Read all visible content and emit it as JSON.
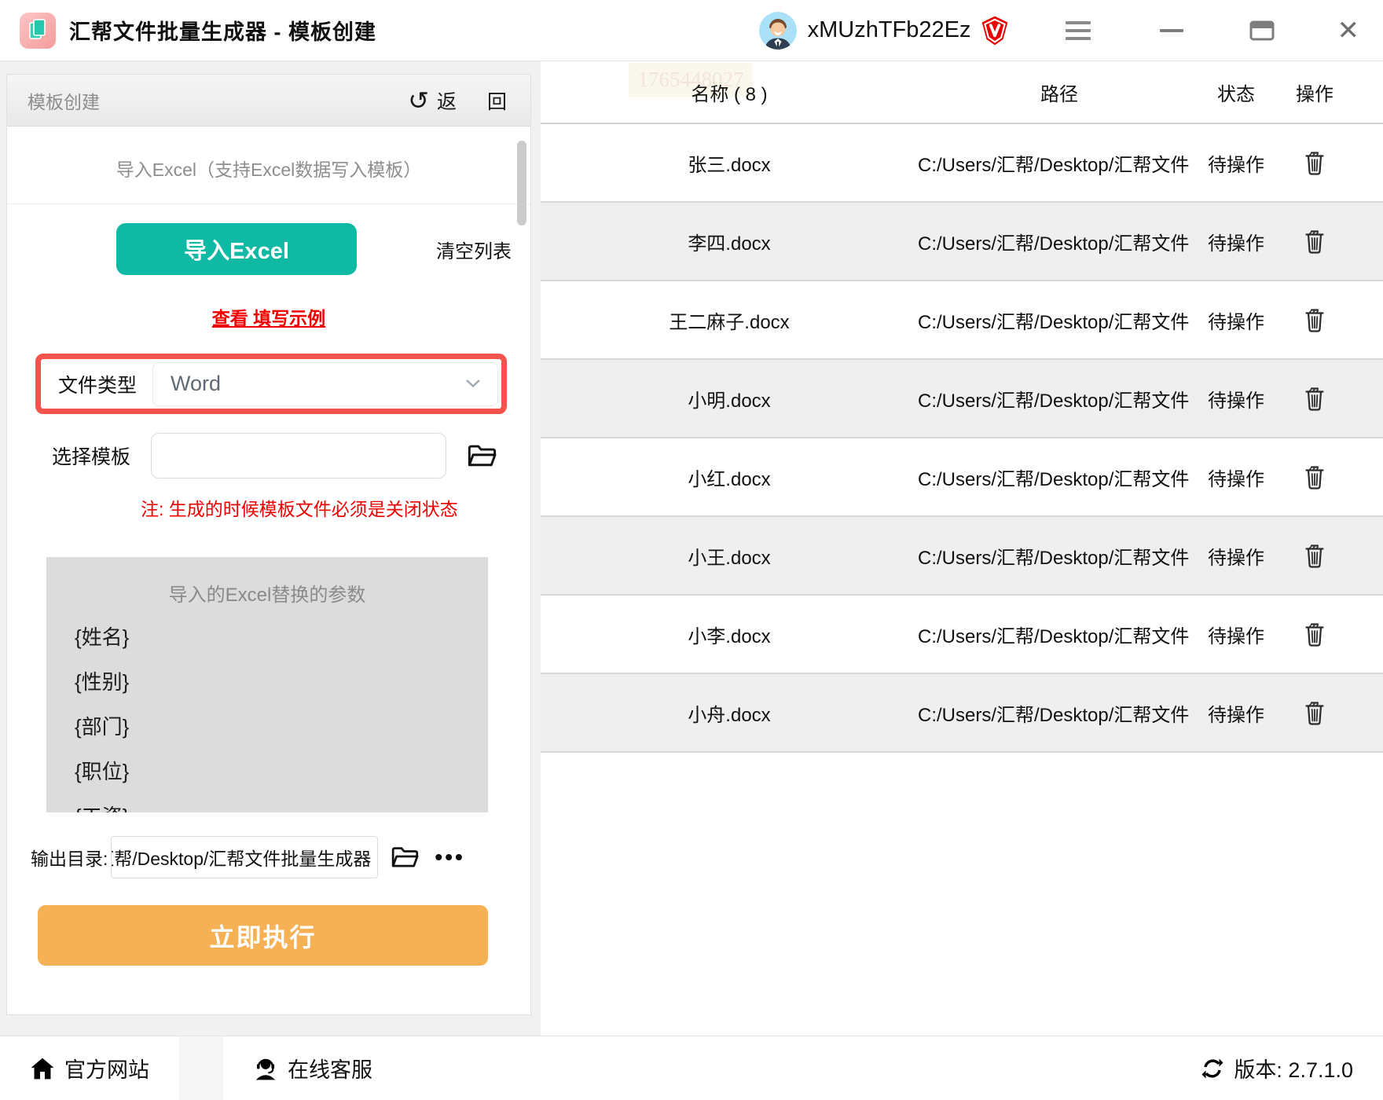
{
  "titlebar": {
    "app_title": "汇帮文件批量生成器 - 模板创建",
    "username": "xMUzhTFb22Ez"
  },
  "panel": {
    "header_title": "模板创建",
    "back_icon": "↺",
    "back_label": "返 回",
    "import_hint": "导入Excel（支持Excel数据写入模板）",
    "import_button": "导入Excel",
    "clear_list": "清空列表",
    "example_link": "查看 填写示例",
    "file_type_label": "文件类型",
    "file_type_value": "Word",
    "template_label": "选择模板",
    "template_value": "",
    "note": "注: 生成的时候模板文件必须是关闭状态",
    "params_title": "导入的Excel替换的参数",
    "params": [
      "{姓名}",
      "{性别}",
      "{部门}",
      "{职位}",
      "{工资}"
    ],
    "output_label": "输出目录:",
    "output_value": "汇帮/Desktop/汇帮文件批量生成器",
    "more_label": "•••",
    "execute_button": "立即执行"
  },
  "table": {
    "watermark": "1765448027",
    "columns": [
      "名称 ( 8 )",
      "路径",
      "状态",
      "操作"
    ],
    "rows": [
      {
        "name": "张三.docx",
        "path": "C:/Users/汇帮/Desktop/汇帮文件",
        "status": "待操作"
      },
      {
        "name": "李四.docx",
        "path": "C:/Users/汇帮/Desktop/汇帮文件",
        "status": "待操作"
      },
      {
        "name": "王二麻子.docx",
        "path": "C:/Users/汇帮/Desktop/汇帮文件",
        "status": "待操作"
      },
      {
        "name": "小明.docx",
        "path": "C:/Users/汇帮/Desktop/汇帮文件",
        "status": "待操作"
      },
      {
        "name": "小红.docx",
        "path": "C:/Users/汇帮/Desktop/汇帮文件",
        "status": "待操作"
      },
      {
        "name": "小王.docx",
        "path": "C:/Users/汇帮/Desktop/汇帮文件",
        "status": "待操作"
      },
      {
        "name": "小李.docx",
        "path": "C:/Users/汇帮/Desktop/汇帮文件",
        "status": "待操作"
      },
      {
        "name": "小舟.docx",
        "path": "C:/Users/汇帮/Desktop/汇帮文件",
        "status": "待操作"
      }
    ]
  },
  "footer": {
    "site": "官方网站",
    "support": "在线客服",
    "version": "版本: 2.7.1.0"
  },
  "colors": {
    "accent_teal": "#10b9a3",
    "accent_orange": "#f7b155",
    "annotation_red": "#f2544d",
    "note_red": "#ef0000",
    "row_alt": "#efefef",
    "watermark_bg": "#faf8ec"
  }
}
